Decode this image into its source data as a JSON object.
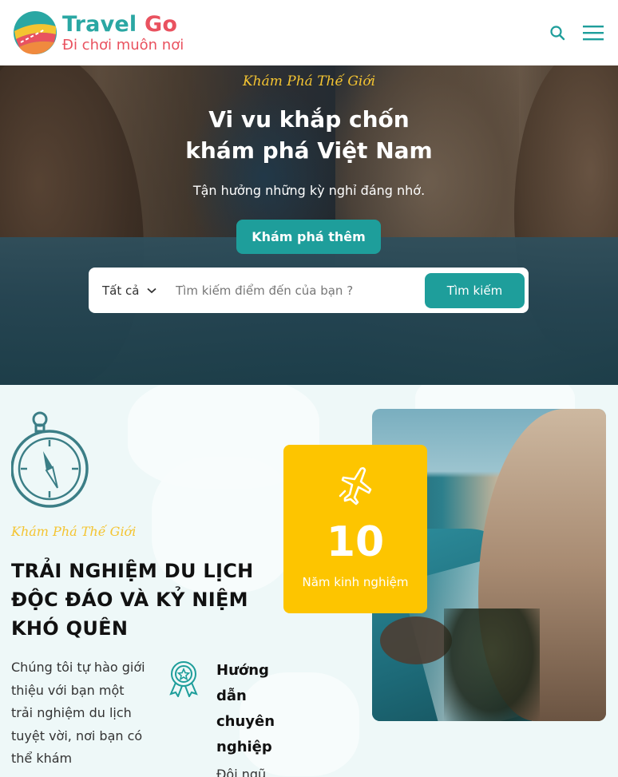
{
  "header": {
    "logo_title_part1": "Travel",
    "logo_title_part2": "Go",
    "logo_subtitle": "Đi chơi muôn nơi",
    "search_icon": "search-icon",
    "menu_icon": "hamburger-menu-icon"
  },
  "hero": {
    "kicker": "Khám Phá Thế Giới",
    "title_line1": "Vi vu khắp chốn",
    "title_line2": "khám phá Việt Nam",
    "subtitle": "Tận hưởng những kỳ nghỉ đáng nhớ.",
    "cta_label": "Khám phá thêm",
    "search": {
      "category": "Tất cả",
      "placeholder": "Tìm kiếm điểm đến của bạn ?",
      "button_label": "Tìm kiếm"
    }
  },
  "about": {
    "kicker": "Khám Phá Thế Giới",
    "title": "TRẢI NGHIỆM DU LỊCH ĐỘC ĐÁO VÀ KỶ NIỆM KHÓ QUÊN",
    "text": "Chúng tôi tự hào giới thiệu với bạn một trải nghiệm du lịch tuyệt vời, nơi bạn có thể khám",
    "feature": {
      "title": "Hướng dẫn chuyên nghiệp",
      "icon": "award-ribbon-icon"
    },
    "stat": {
      "number": "10",
      "label": "Năm kinh nghiệm",
      "icon": "airplane-icon"
    }
  },
  "colors": {
    "accent_teal": "#1e9e9b",
    "accent_red": "#e9525f",
    "accent_yellow": "#fdc500",
    "script_gold": "#f4c431"
  }
}
